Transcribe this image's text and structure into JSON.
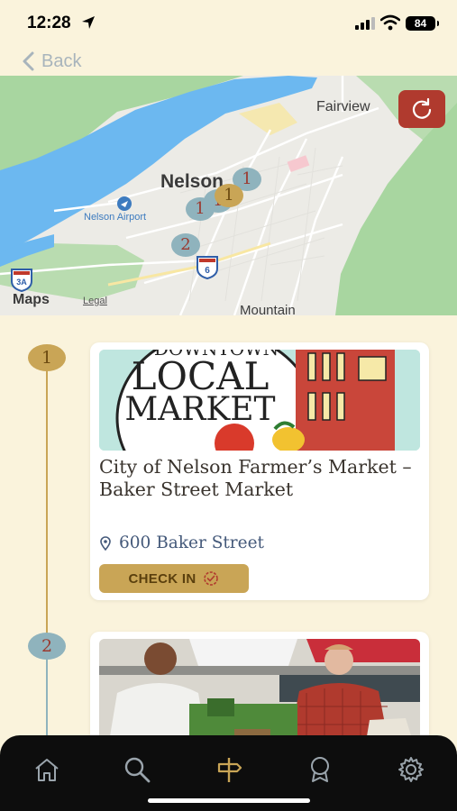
{
  "status_bar": {
    "time": "12:28",
    "battery": "84"
  },
  "nav": {
    "back_label": "Back"
  },
  "map": {
    "labels": {
      "fairview": "Fairview",
      "nelson": "Nelson",
      "airport": "Nelson Airport",
      "mountain": "Mountain",
      "maps": "Maps",
      "legal": "Legal"
    },
    "route_shields": [
      "3A",
      "6"
    ],
    "pins": [
      {
        "label": "1",
        "color": "blue"
      },
      {
        "label": "1",
        "color": "gold"
      },
      {
        "label": "1",
        "color": "blue"
      },
      {
        "label": "2",
        "color": "blue"
      },
      {
        "label": "1",
        "color": "blue"
      }
    ],
    "refresh_icon": "refresh-icon"
  },
  "locations": [
    {
      "step": "1",
      "image_text": [
        "DOWNTOWN",
        "LOCAL",
        "MARKET"
      ],
      "title": "City of Nelson Farmer’s Market – Baker Street Market",
      "address": "600 Baker Street",
      "check_in_label": "CHECK IN"
    },
    {
      "step": "2"
    }
  ],
  "tabs": [
    {
      "name": "home",
      "icon": "home-icon"
    },
    {
      "name": "search",
      "icon": "search-icon"
    },
    {
      "name": "trails",
      "icon": "signpost-icon"
    },
    {
      "name": "rewards",
      "icon": "badge-icon"
    },
    {
      "name": "settings",
      "icon": "gear-icon"
    }
  ],
  "colors": {
    "accent_gold": "#c9a556",
    "accent_blue": "#8fb3bd",
    "accent_red": "#b03a2e",
    "background": "#faf3dc"
  }
}
